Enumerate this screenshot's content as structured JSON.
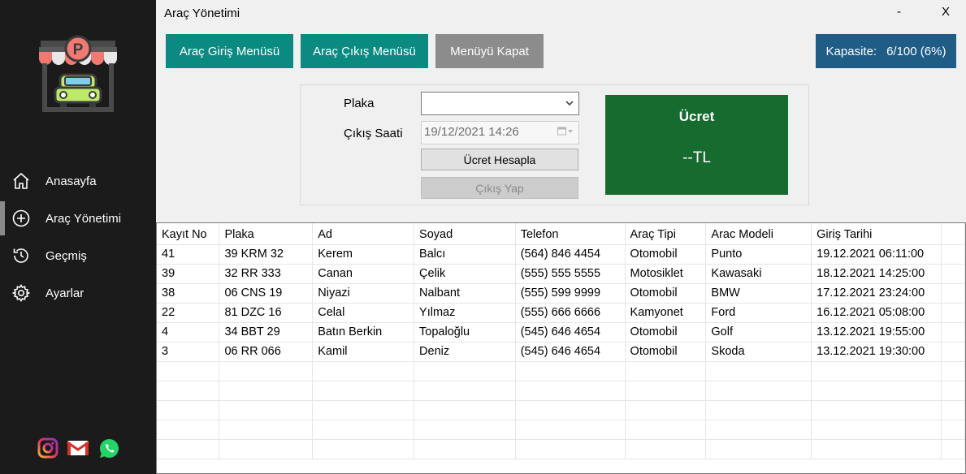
{
  "window": {
    "title": "Araç Yönetimi",
    "minimize": "-",
    "close": "X"
  },
  "sidebar": {
    "items": [
      {
        "label": "Anasayfa",
        "icon": "home-icon"
      },
      {
        "label": "Araç Yönetimi",
        "icon": "add-circle-icon",
        "active": true
      },
      {
        "label": "Geçmiş",
        "icon": "history-icon"
      },
      {
        "label": "Ayarlar",
        "icon": "gear-icon"
      }
    ],
    "social": [
      "instagram-icon",
      "gmail-icon",
      "whatsapp-icon"
    ],
    "logo_letter": "P"
  },
  "toolbar": {
    "entry_menu": "Araç Giriş Menüsü",
    "exit_menu": "Araç Çıkış Menüsü",
    "close_menu": "Menüyü Kapat",
    "capacity_label": "Kapasite:",
    "capacity_value": "6/100 (6%)"
  },
  "form": {
    "plate_label": "Plaka",
    "plate_value": "",
    "exit_time_label": "Çıkış Saati",
    "exit_time_value": "19/12/2021 14:26",
    "calc_button": "Ücret Hesapla",
    "exit_button": "Çıkış Yap"
  },
  "fee": {
    "title": "Ücret",
    "value": "--TL"
  },
  "table": {
    "columns": [
      "Kayıt No",
      "Plaka",
      "Ad",
      "Soyad",
      "Telefon",
      "Araç Tipi",
      "Arac Modeli",
      "Giriş Tarihi",
      ""
    ],
    "rows": [
      [
        "41",
        "39 KRM 32",
        "Kerem",
        "Balcı",
        "(564) 846 4454",
        "Otomobil",
        "Punto",
        "19.12.2021 06:11:00",
        ""
      ],
      [
        "39",
        "32 RR 333",
        "Canan",
        "Çelik",
        "(555) 555 5555",
        "Motosiklet",
        "Kawasaki",
        "18.12.2021 14:25:00",
        ""
      ],
      [
        "38",
        "06 CNS 19",
        "Niyazi",
        "Nalbant",
        "(555) 599 9999",
        "Otomobil",
        "BMW",
        "17.12.2021 23:24:00",
        ""
      ],
      [
        "22",
        "81 DZC 16",
        "Celal",
        "Yılmaz",
        "(555) 666 6666",
        "Kamyonet",
        "Ford",
        "16.12.2021 05:08:00",
        ""
      ],
      [
        "4",
        "34 BBT 29",
        "Batın Berkin",
        "Topaloğlu",
        "(545) 646 4654",
        "Otomobil",
        "Golf",
        "13.12.2021 19:55:00",
        ""
      ],
      [
        "3",
        "06 RR 066",
        "Kamil",
        "Deniz",
        "(545) 646 4654",
        "Otomobil",
        "Skoda",
        "13.12.2021 19:30:00",
        ""
      ]
    ],
    "empty_rows": 5
  },
  "colors": {
    "sidebar_bg": "#1b1b1b",
    "teal_button": "#0b8a82",
    "gray_button": "#8c8c8c",
    "capacity_bg": "#1f5c86",
    "fee_bg": "#166b2e"
  }
}
